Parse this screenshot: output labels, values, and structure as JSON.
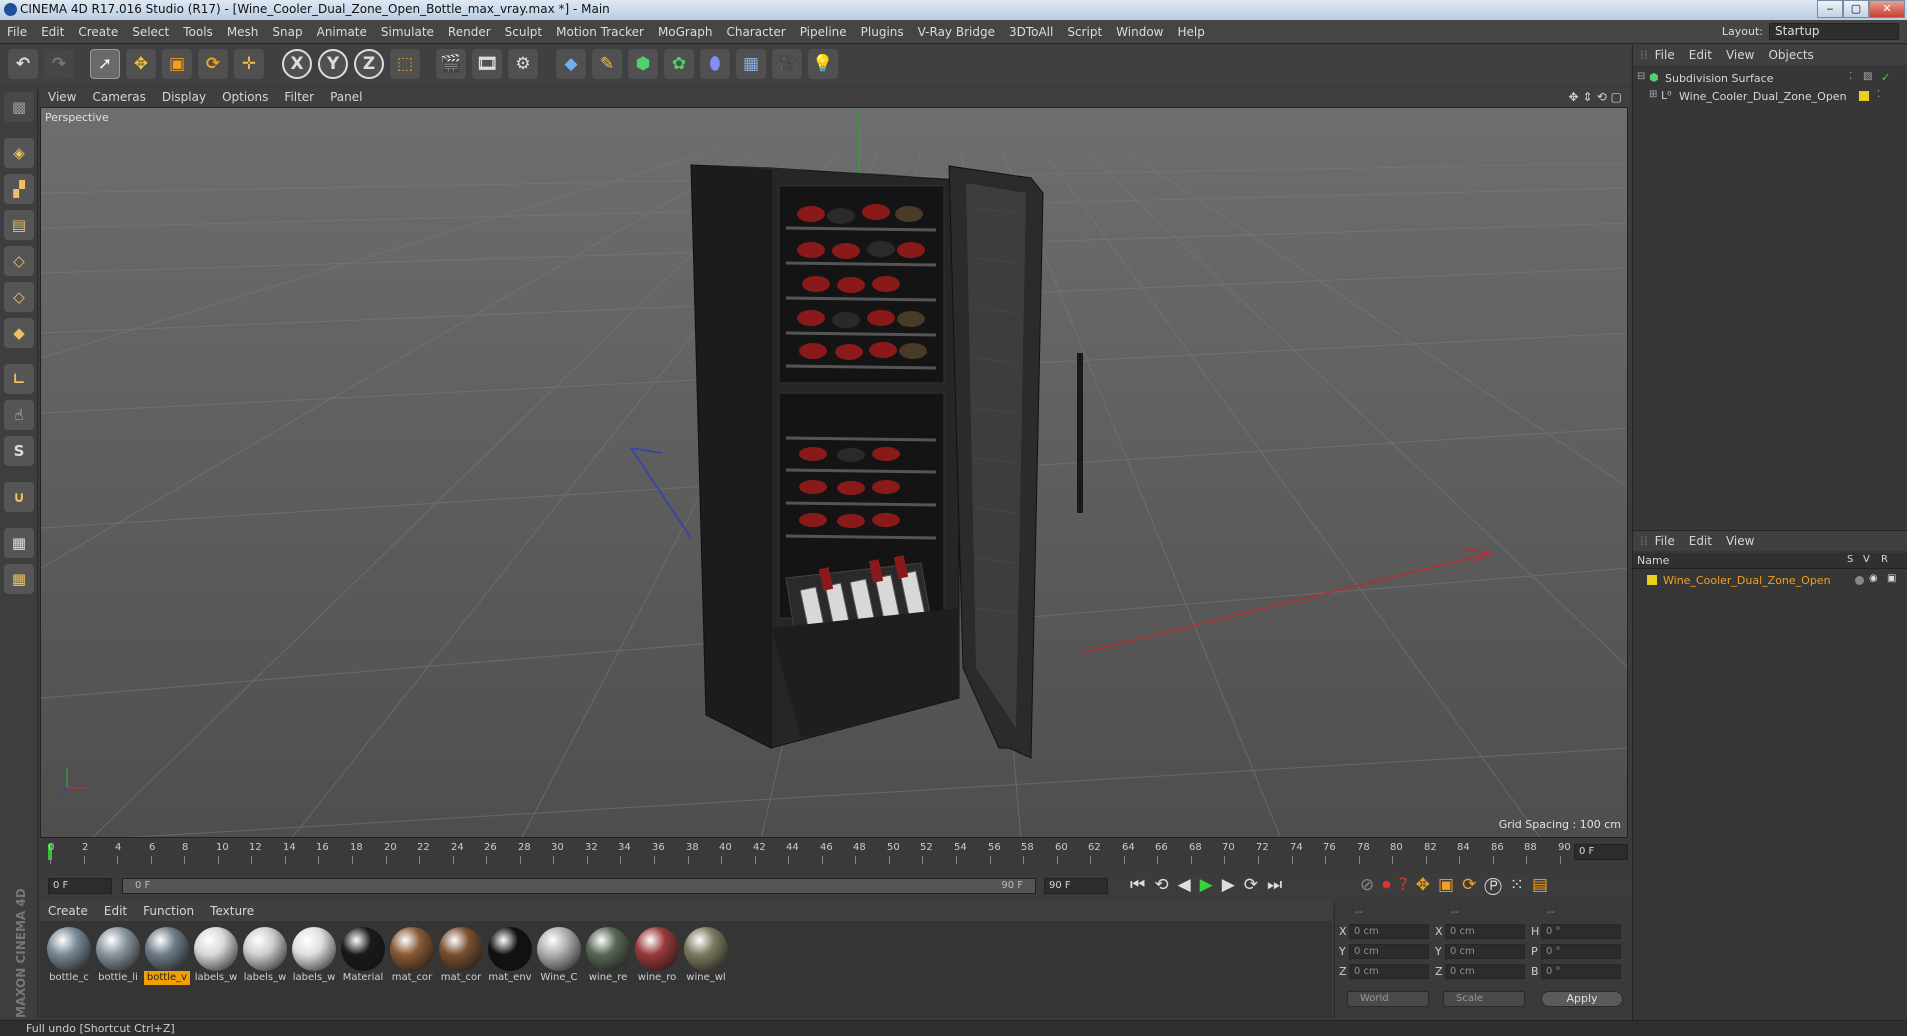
{
  "window": {
    "title": "CINEMA 4D R17.016 Studio (R17) - [Wine_Cooler_Dual_Zone_Open_Bottle_max_vray.max *] - Main",
    "btn_min": "‒",
    "btn_max": "▢",
    "btn_close": "✕"
  },
  "menu": [
    "File",
    "Edit",
    "Create",
    "Select",
    "Tools",
    "Mesh",
    "Snap",
    "Animate",
    "Simulate",
    "Render",
    "Sculpt",
    "Motion Tracker",
    "MoGraph",
    "Character",
    "Pipeline",
    "Plugins",
    "V-Ray Bridge",
    "3DToAll",
    "Script",
    "Window",
    "Help"
  ],
  "layout": {
    "label": "Layout:",
    "value": "Startup"
  },
  "toolbar": {
    "x": "X",
    "y": "Y",
    "z": "Z"
  },
  "viewport": {
    "menu": [
      "View",
      "Cameras",
      "Display",
      "Options",
      "Filter",
      "Panel"
    ],
    "label": "Perspective",
    "grid_spacing": "Grid Spacing : 100 cm"
  },
  "timeline": {
    "ticks": [
      "0",
      "2",
      "4",
      "6",
      "8",
      "10",
      "12",
      "14",
      "16",
      "18",
      "20",
      "22",
      "24",
      "26",
      "28",
      "30",
      "32",
      "34",
      "36",
      "38",
      "40",
      "42",
      "44",
      "46",
      "48",
      "50",
      "52",
      "54",
      "56",
      "58",
      "60",
      "62",
      "64",
      "66",
      "68",
      "70",
      "72",
      "74",
      "76",
      "78",
      "80",
      "82",
      "84",
      "86",
      "88",
      "90"
    ],
    "current": "0 F",
    "start": "0 F",
    "range_start": "0 F",
    "range_end": "90 F",
    "end": "90 F"
  },
  "materials": {
    "menu": [
      "Create",
      "Edit",
      "Function",
      "Texture"
    ],
    "items": [
      {
        "label": "bottle_c",
        "color": "#7a8a96"
      },
      {
        "label": "bottle_li",
        "color": "#8a96a0"
      },
      {
        "label": "bottle_v",
        "color": "#6f7e8a",
        "selected": true
      },
      {
        "label": "labels_w",
        "color": "#d8d8d8"
      },
      {
        "label": "labels_w",
        "color": "#cfcfcf"
      },
      {
        "label": "labels_w",
        "color": "#e0e0e0"
      },
      {
        "label": "Material",
        "color": "#1a1a1a"
      },
      {
        "label": "mat_cor",
        "color": "#8a5a34"
      },
      {
        "label": "mat_cor",
        "color": "#7a5030"
      },
      {
        "label": "mat_env",
        "color": "#111111"
      },
      {
        "label": "Wine_C",
        "color": "#b0b0b0"
      },
      {
        "label": "wine_re",
        "color": "#5a6658"
      },
      {
        "label": "wine_ro",
        "color": "#9a3a3a"
      },
      {
        "label": "wine_wl",
        "color": "#7e7a60"
      }
    ]
  },
  "coords": {
    "header": [
      "--",
      "--",
      "--"
    ],
    "rows": [
      {
        "a": "X",
        "av": "0 cm",
        "b": "X",
        "bv": "0 cm",
        "c": "H",
        "cv": "0 °"
      },
      {
        "a": "Y",
        "av": "0 cm",
        "b": "Y",
        "bv": "0 cm",
        "c": "P",
        "cv": "0 °"
      },
      {
        "a": "Z",
        "av": "0 cm",
        "b": "Z",
        "bv": "0 cm",
        "c": "B",
        "cv": "0 °"
      }
    ],
    "world": "World",
    "scale": "Scale",
    "apply": "Apply"
  },
  "object_manager": {
    "menu": [
      "File",
      "Edit",
      "View",
      "Objects"
    ],
    "items": [
      "Subdivision Surface",
      "Wine_Cooler_Dual_Zone_Open"
    ]
  },
  "attribute_manager": {
    "menu": [
      "File",
      "Edit",
      "View"
    ],
    "columns": {
      "name": "Name",
      "s": "S",
      "v": "V",
      "r": "R"
    },
    "item": "Wine_Cooler_Dual_Zone_Open"
  },
  "status": "Full undo [Shortcut Ctrl+Z]",
  "brand": "MAXON CINEMA 4D"
}
